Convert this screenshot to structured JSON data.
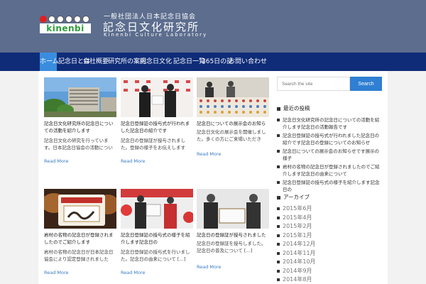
{
  "header": {
    "logo_text": "kinenbi",
    "subtitle": "一般社団法人日本記念日協会",
    "title": "記念日文化研究所",
    "english": "Kinenbi Culture Laboratory"
  },
  "nav": {
    "items": [
      "ホーム",
      "記念日とは",
      "会社概要",
      "研究所の案内",
      "記念日文化",
      "記念日一覧",
      "365日の記",
      "お問い合わせ"
    ]
  },
  "posts": [
    {
      "title": "記念日文化研究所の記念日についての活動を紹介します",
      "excerpt": "記念日文化の研究を行っています。日本記念日協会の活動について […]",
      "read_more": "Read More"
    },
    {
      "title": "記念日登録証の授与式が行われました記念日の紹介です",
      "excerpt": "記念日の登録証が授与されました。登録の様子をお伝えします […]",
      "read_more": "Read More"
    },
    {
      "title": "記念日についての展示会のお知らせです",
      "excerpt": "記念日文化の展示会を開催しました。多くの方にご来場いただき […]",
      "read_more": "Read More"
    },
    {
      "title": "岩村の名物の記念日が登録されましたのでご紹介します",
      "excerpt": "岩村の名物の記念日が日本記念日協会により認定登録されました […]",
      "read_more": "Read More"
    },
    {
      "title": "記念日登録証の授与式の様子を紹介します記念日の",
      "excerpt": "記念日登録証の授与式を行いました。記念日の由来について […]",
      "read_more": "Read More"
    },
    {
      "title": "記念日の登録証が授与されました",
      "excerpt": "記念日の登録証を授与しました。記念日の普及について […]",
      "read_more": "Read More"
    }
  ],
  "search": {
    "placeholder": "Search the site",
    "button": "Search"
  },
  "sidebar": {
    "recent_title": "最近の投稿",
    "recent_posts": [
      "記念日文化研究所の記念日についての活動を紹介します記念日の活動報告です",
      "記念日登録証の授与式が行われました記念日の紹介です記念日の登録についてのお知らせ",
      "記念日についての展示会のお知らせです展示の様子",
      "岩村の名物の記念日が登録されましたのでご紹介します記念日の由来について",
      "記念日登録証の授与式の様子を紹介します記念日の"
    ],
    "archive_title": "アーカイブ",
    "archives": [
      "2015年6月",
      "2015年4月",
      "2015年2月",
      "2015年1月",
      "2014年12月",
      "2014年11月",
      "2014年10月",
      "2014年9月",
      "2014年8月"
    ]
  },
  "colors": {
    "header_bg": "#5c6d8e",
    "nav_bg": "#0f2c78",
    "nav_active": "#3a8dde",
    "link": "#3a7cc7",
    "search_button": "#2f7fd2"
  }
}
